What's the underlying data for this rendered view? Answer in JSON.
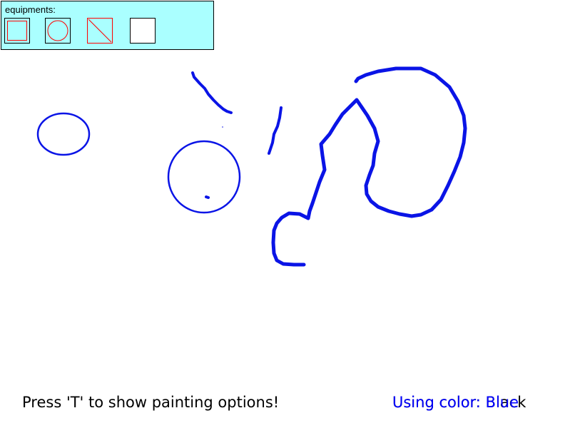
{
  "toolbox": {
    "title": "equipments:",
    "tools": [
      {
        "name": "rectangle-tool",
        "icon": "rectangle-icon"
      },
      {
        "name": "circle-tool",
        "icon": "circle-icon"
      },
      {
        "name": "line-tool",
        "icon": "line-icon"
      },
      {
        "name": "eraser-tool",
        "icon": "blank-icon"
      }
    ],
    "accent": "#ff0000",
    "background": "#aaffff"
  },
  "stroke_color": "#0a14e6",
  "hint_text": "Press 'T' to show painting options!",
  "status": {
    "current_color_text": "Using color: Blue",
    "previous_color_text": "Using color: Black",
    "current_color": "#0000ff",
    "previous_color": "#000000"
  }
}
